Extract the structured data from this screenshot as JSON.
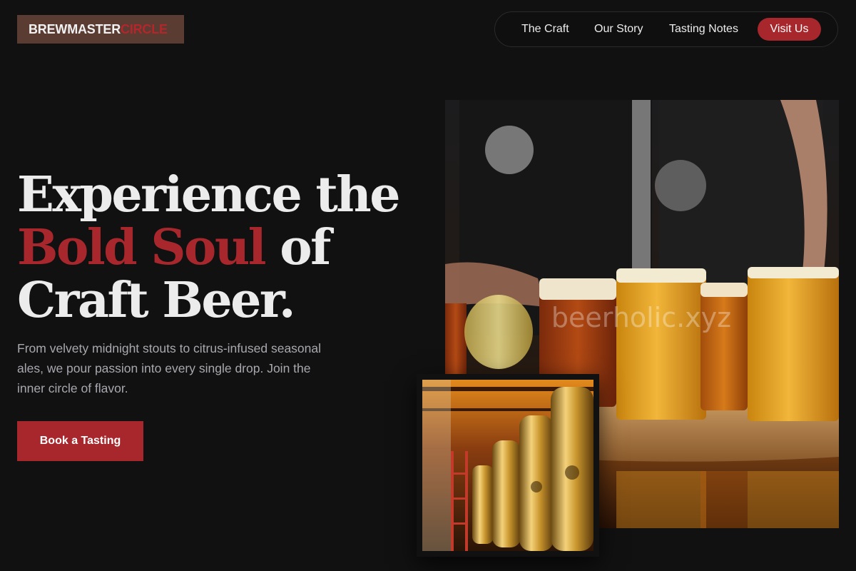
{
  "brand": {
    "name_part1": "BREWMASTER",
    "name_part2": "CIRCLE"
  },
  "nav": {
    "links": [
      "The Craft",
      "Our Story",
      "Tasting Notes"
    ],
    "cta": "Visit Us"
  },
  "hero": {
    "line1": "Experience the",
    "accent": "Bold Soul",
    "line2_rest": " of",
    "line3": "Craft Beer.",
    "subtitle": "From velvety midnight stouts to citrus-infused seasonal ales, we pour passion into every single drop. Join the inner circle of flavor.",
    "button": "Book a Tasting"
  },
  "images": {
    "main": {
      "watermark": "beerholic.xyz"
    }
  },
  "colors": {
    "accent": "#a8272c",
    "background": "#111112",
    "logo_bg": "#5a3c33"
  }
}
